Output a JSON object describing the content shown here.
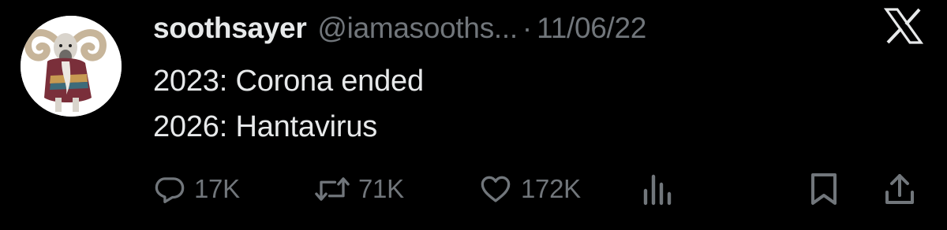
{
  "tweet": {
    "display_name": "soothsayer",
    "handle": "@iamasooths...",
    "separator": "·",
    "date": "11/06/22",
    "lines": [
      "2023: Corona ended",
      "2026: Hantavirus"
    ],
    "avatar_icon": "ram-character-avatar",
    "brand_icon": "x-logo-icon"
  },
  "actions": {
    "reply": {
      "icon": "reply-icon",
      "count": "17K"
    },
    "repost": {
      "icon": "repost-icon",
      "count": "71K"
    },
    "like": {
      "icon": "heart-icon",
      "count": "172K"
    },
    "views": {
      "icon": "views-icon"
    },
    "bookmark": {
      "icon": "bookmark-icon"
    },
    "share": {
      "icon": "share-icon"
    }
  },
  "colors": {
    "background": "#000000",
    "primary_text": "#e7e9ea",
    "secondary_text": "#71767b"
  }
}
